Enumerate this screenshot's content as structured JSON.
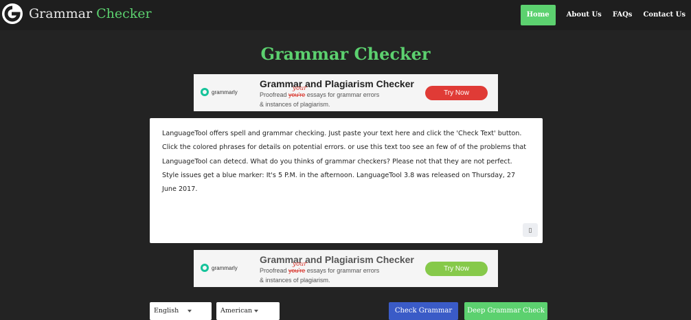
{
  "header": {
    "logo_text_main": "Grammar",
    "logo_text_accent": "Checker",
    "nav": [
      {
        "label": "Home",
        "active": true
      },
      {
        "label": "About Us",
        "active": false
      },
      {
        "label": "FAQs",
        "active": false
      },
      {
        "label": "Contact Us",
        "active": false
      }
    ]
  },
  "page_title": "Grammar Checker",
  "ad": {
    "brand": "grammarly",
    "title": "Grammar and Plagiarism Checker",
    "line1_pre": "Proofread ",
    "line1_strike": "you're",
    "line1_post": " essays for grammar errors",
    "correction": "your",
    "line2": "& instances of plagiarism.",
    "button": "Try Now"
  },
  "editor": {
    "text": "LanguageTool offers spell and grammar checking. Just paste your text here and click the 'Check Text' button. Click the colored phrases for details on potential errors. or use this text too see an few of of the problems that LanguageTool can detecd. What do you thinks of grammar checkers? Please not that they are not perfect. Style issues get a blue marker: It's 5 P.M. in the afternoon. LanguageTool 3.8 was released on Thursday, 27 June 2017."
  },
  "controls": {
    "language": "English",
    "variant": "American",
    "check_button": "Check Grammar",
    "deep_button": "Deep Grammar Check"
  },
  "colors": {
    "accent": "#5cd16f",
    "check_button": "#3a5bc7",
    "background": "#232323"
  }
}
